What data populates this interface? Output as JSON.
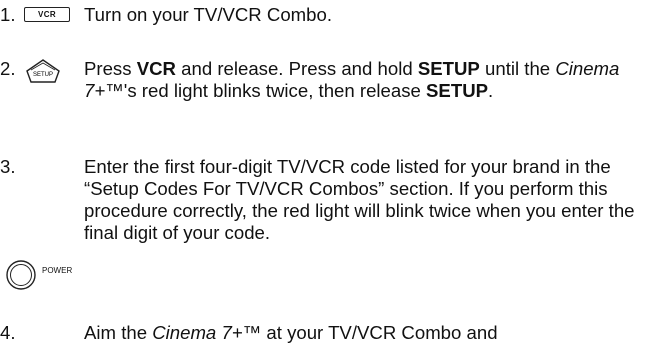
{
  "steps": [
    {
      "number": "1.",
      "button_label": "VCR",
      "text": "Turn on your TV/VCR Combo."
    },
    {
      "number": "2.",
      "button_label": "SETUP",
      "press": "Press ",
      "vcr": "VCR",
      "and_release": " and release. Press and hold ",
      "setup": "SETUP",
      "until": " until the ",
      "cinema": "Cinema 7+™",
      "s_red": "'s red light blinks twice, then release ",
      "setup2": "SETUP",
      "end": "."
    },
    {
      "number": "3.",
      "button_label": "POWER",
      "text": "Enter the first four-digit TV/VCR code listed for your brand in the “Setup Codes For TV/VCR Combos” section. If you perform this procedure correctly, the red light will blink twice when you enter the final digit of your code."
    },
    {
      "number": "4.",
      "aim": "Aim the ",
      "cinema": "Cinema 7+™",
      "at": " at your TV/VCR Combo and"
    }
  ]
}
